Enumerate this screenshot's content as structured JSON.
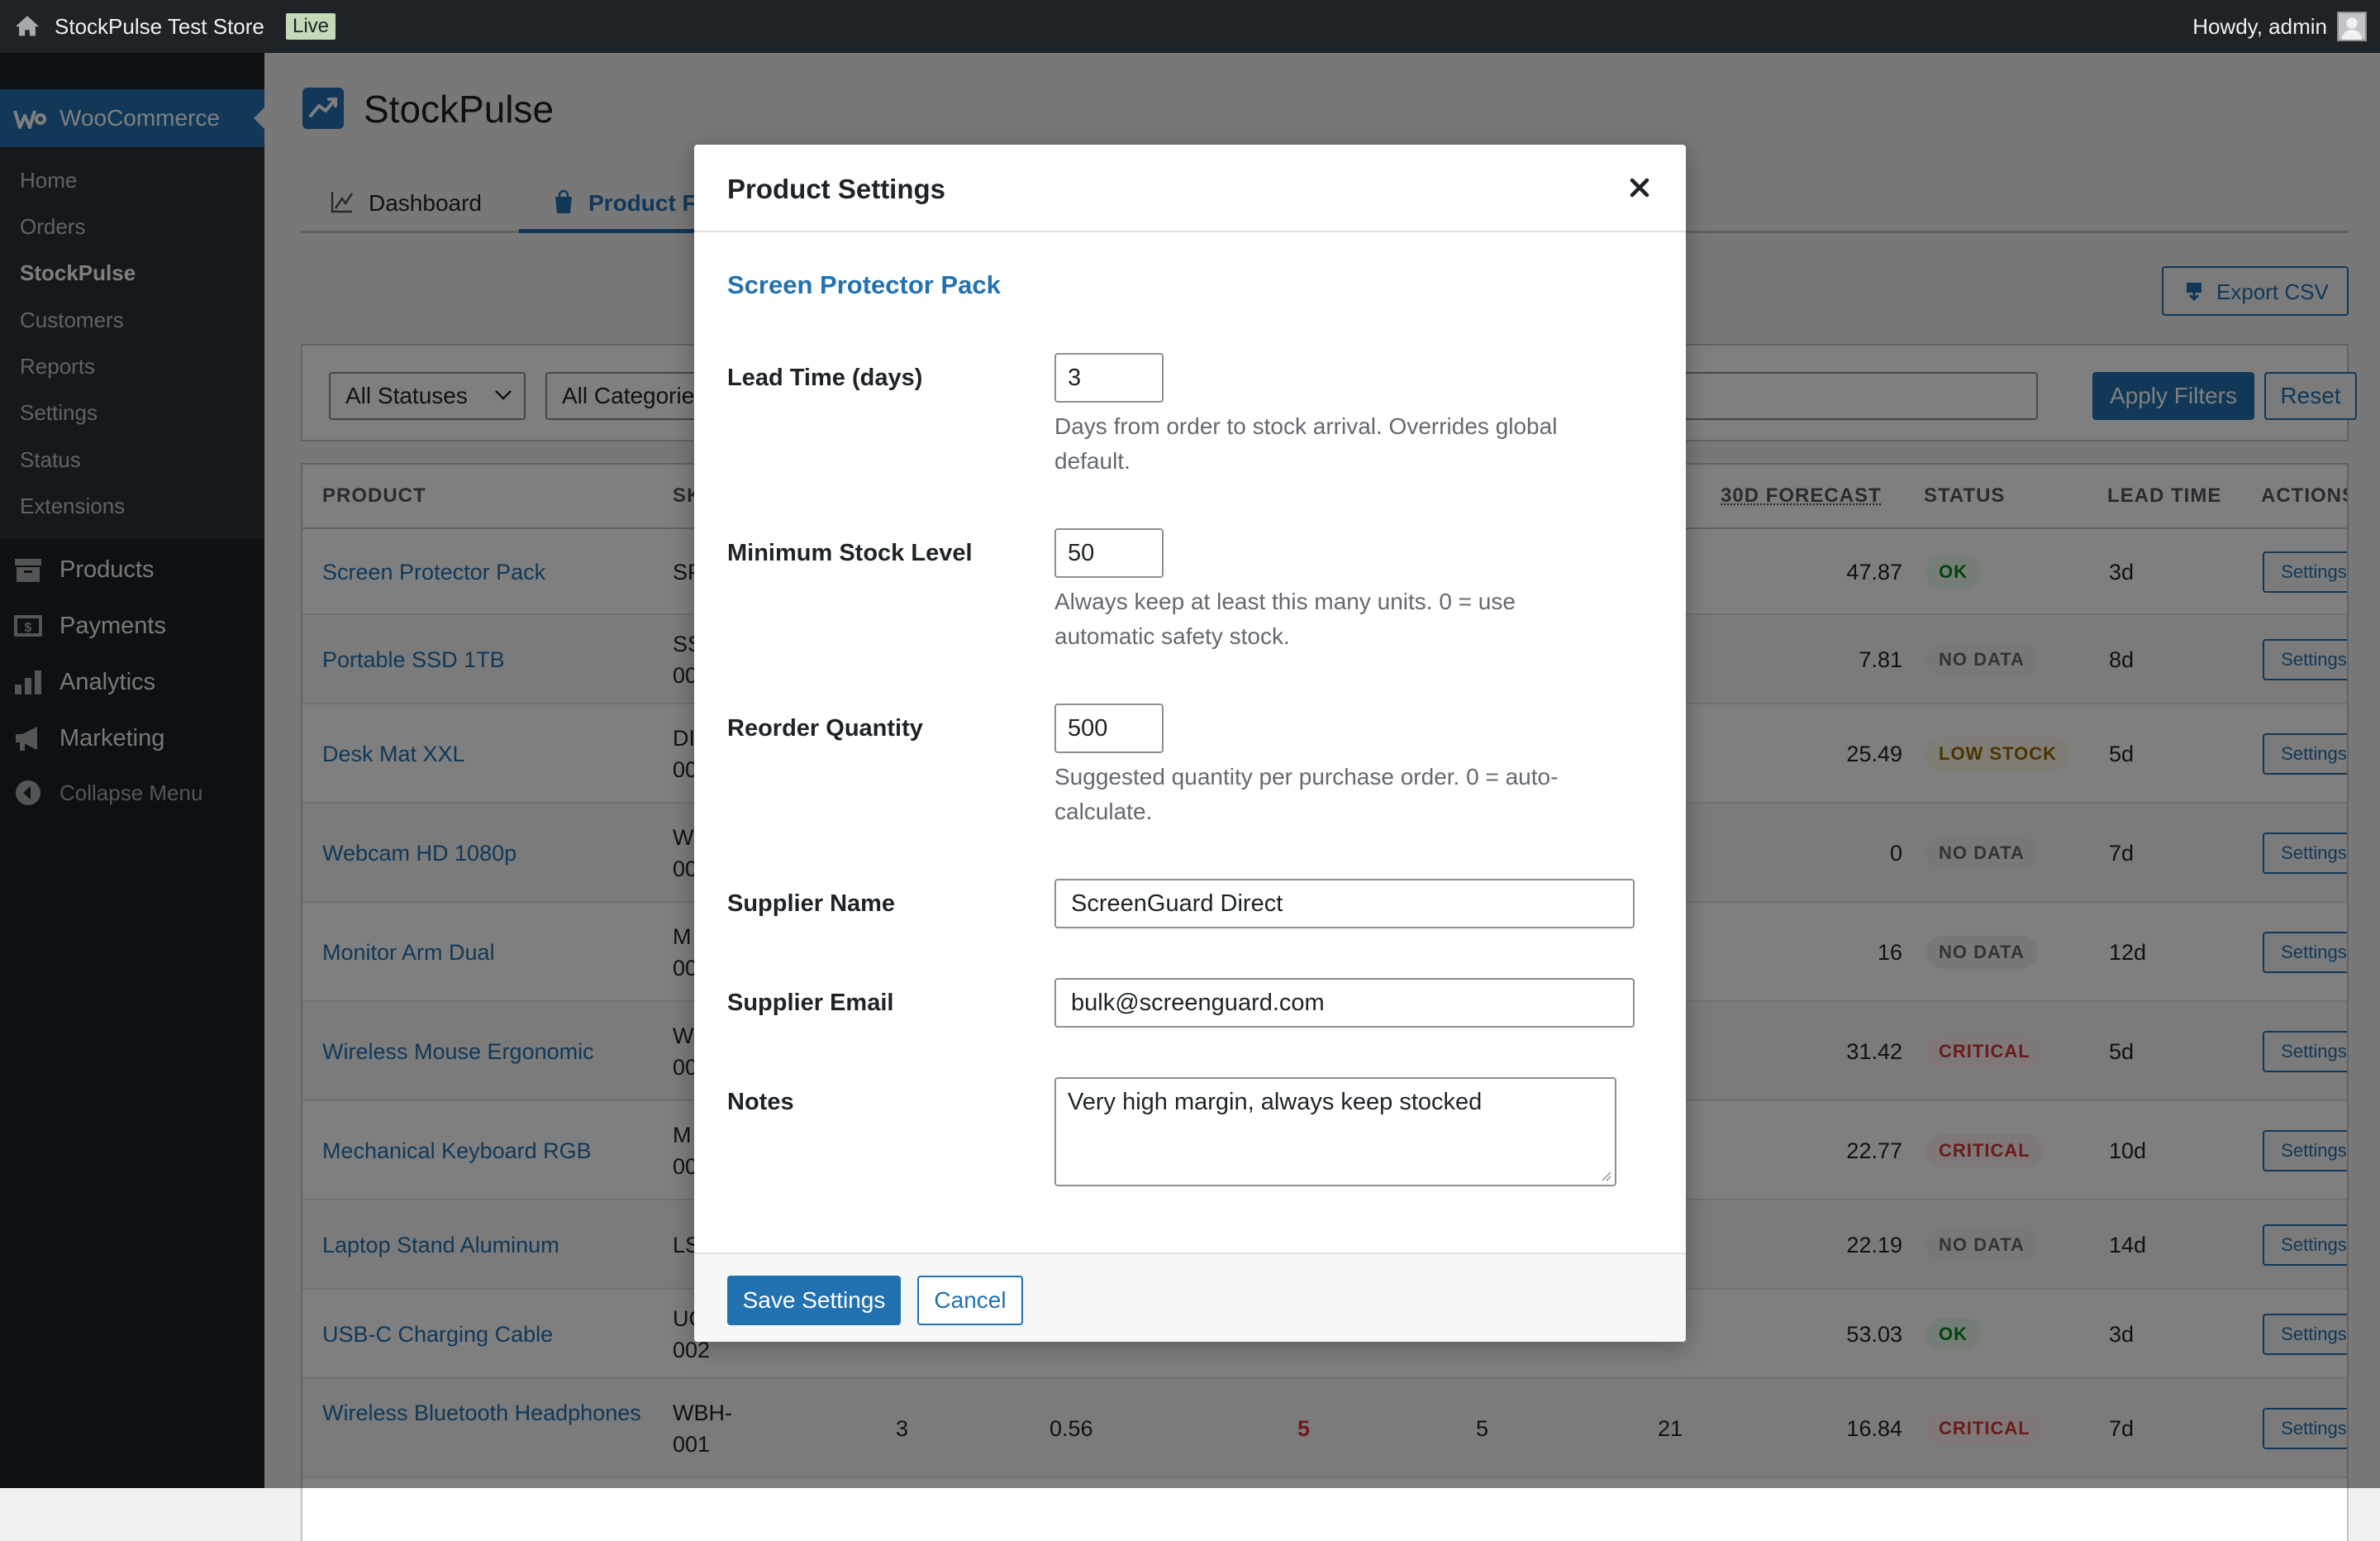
{
  "adminbar": {
    "site_name": "StockPulse Test Store",
    "live_badge": "Live",
    "howdy": "Howdy, admin"
  },
  "sidebar": {
    "woocommerce_label": "WooCommerce",
    "sub_items": [
      "Home",
      "Orders",
      "StockPulse",
      "Customers",
      "Reports",
      "Settings",
      "Status",
      "Extensions"
    ],
    "current_sub": "StockPulse",
    "menu": [
      {
        "label": "Products",
        "icon": "archive-icon"
      },
      {
        "label": "Payments",
        "icon": "dollar-icon"
      },
      {
        "label": "Analytics",
        "icon": "bar-chart-icon"
      },
      {
        "label": "Marketing",
        "icon": "megaphone-icon"
      },
      {
        "label": "Collapse Menu",
        "icon": "collapse-icon"
      }
    ]
  },
  "page": {
    "title": "StockPulse",
    "tabs": [
      {
        "label": "Dashboard",
        "icon": "chart-line-icon"
      },
      {
        "label": "Product Forecasts",
        "icon": "bag-icon",
        "visible_text": "Product F"
      }
    ],
    "export_label": "Export CSV"
  },
  "filters": {
    "status_select": "All Statuses",
    "category_select": "All Categories",
    "category_visible": "All Categorie",
    "apply_label": "Apply Filters",
    "reset_label": "Reset"
  },
  "table": {
    "headers": {
      "product": "PRODUCT",
      "sku": "SK",
      "forecast": "30D FORECAST",
      "status": "STATUS",
      "lead_time": "LEAD TIME",
      "actions": "ACTIONS"
    },
    "rows": [
      {
        "name": "Screen Protector Pack",
        "sku": "SP",
        "forecast": "47.87",
        "status": "OK",
        "status_type": "ok",
        "lead": "3d"
      },
      {
        "name": "Portable SSD 1TB",
        "sku": "SS 00",
        "forecast": "7.81",
        "status": "NO DATA",
        "status_type": "nodata",
        "lead": "8d"
      },
      {
        "name": "Desk Mat XXL",
        "sku": "DI 00",
        "forecast": "25.49",
        "status": "LOW STOCK",
        "status_type": "low",
        "lead": "5d"
      },
      {
        "name": "Webcam HD 1080p",
        "sku": "W 00",
        "forecast": "0",
        "status": "NO DATA",
        "status_type": "nodata",
        "lead": "7d"
      },
      {
        "name": "Monitor Arm Dual",
        "sku": "M 00",
        "forecast": "16",
        "status": "NO DATA",
        "status_type": "nodata",
        "lead": "12d"
      },
      {
        "name": "Wireless Mouse Ergonomic",
        "sku": "W 00",
        "forecast": "31.42",
        "status": "CRITICAL",
        "status_type": "critical",
        "lead": "5d"
      },
      {
        "name": "Mechanical Keyboard RGB",
        "sku": "M 00",
        "forecast": "22.77",
        "status": "CRITICAL",
        "status_type": "critical",
        "lead": "10d"
      },
      {
        "name": "Laptop Stand Aluminum",
        "sku": "LS",
        "forecast": "22.19",
        "status": "NO DATA",
        "status_type": "nodata",
        "lead": "14d"
      },
      {
        "name": "USB-C Charging Cable",
        "sku": "UC 002",
        "forecast": "53.03",
        "status": "OK",
        "status_type": "ok",
        "lead": "3d"
      },
      {
        "name": "Wireless Bluetooth Headphones",
        "sku": "WBH- 001",
        "col3": "3",
        "col4": "0.56",
        "col5": "5",
        "col6": "5",
        "col7": "21",
        "forecast": "16.84",
        "status": "CRITICAL",
        "status_type": "critical",
        "lead": "7d"
      }
    ],
    "action_label": "Settings"
  },
  "modal": {
    "title": "Product Settings",
    "product_name": "Screen Protector Pack",
    "fields": {
      "lead_time": {
        "label": "Lead Time (days)",
        "value": "3",
        "desc": "Days from order to stock arrival. Overrides global default."
      },
      "min_stock": {
        "label": "Minimum Stock Level",
        "value": "50",
        "desc": "Always keep at least this many units. 0 = use automatic safety stock."
      },
      "reorder_qty": {
        "label": "Reorder Quantity",
        "value": "500",
        "desc": "Suggested quantity per purchase order. 0 = auto-calculate."
      },
      "supplier_name": {
        "label": "Supplier Name",
        "value": "ScreenGuard Direct"
      },
      "supplier_email": {
        "label": "Supplier Email",
        "value": "bulk@screenguard.com"
      },
      "notes": {
        "label": "Notes",
        "value": "Very high margin, always keep stocked"
      }
    },
    "save_label": "Save Settings",
    "cancel_label": "Cancel"
  },
  "colors": {
    "admin_dark": "#1d2327",
    "accent": "#2271b1",
    "ok": "#008a20",
    "critical": "#d63638",
    "low_stock": "#996800"
  }
}
